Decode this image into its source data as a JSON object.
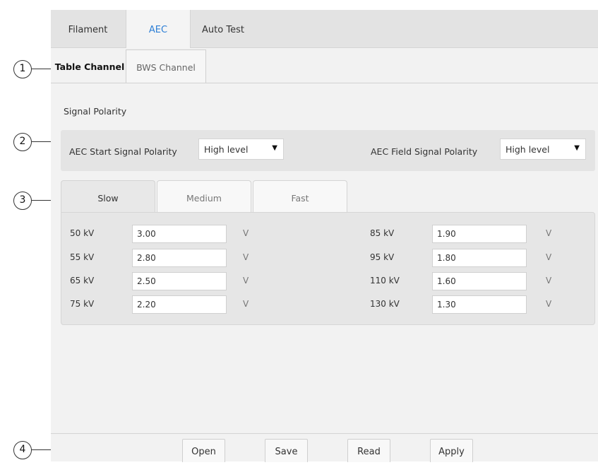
{
  "top_tabs": [
    "Filament",
    "AEC",
    "Auto Test"
  ],
  "sub_tabs": [
    "Table Channel",
    "BWS Channel"
  ],
  "signal_polarity": {
    "section_label": "Signal Polarity",
    "start_label": "AEC Start Signal Polarity",
    "start_value": "High level",
    "field_label": "AEC Field Signal Polarity",
    "field_value": "High level",
    "arrow": "▼"
  },
  "speed_tabs": [
    "Slow",
    "Medium",
    "Fast"
  ],
  "kv_left": [
    {
      "kv": "50 kV",
      "value": "3.00",
      "unit": "V"
    },
    {
      "kv": "55 kV",
      "value": "2.80",
      "unit": "V"
    },
    {
      "kv": "65 kV",
      "value": "2.50",
      "unit": "V"
    },
    {
      "kv": "75 kV",
      "value": "2.20",
      "unit": "V"
    }
  ],
  "kv_right": [
    {
      "kv": "85 kV",
      "value": "1.90",
      "unit": "V"
    },
    {
      "kv": "95 kV",
      "value": "1.80",
      "unit": "V"
    },
    {
      "kv": "110 kV",
      "value": "1.60",
      "unit": "V"
    },
    {
      "kv": "130 kV",
      "value": "1.30",
      "unit": "V"
    }
  ],
  "buttons": [
    "Open",
    "Save",
    "Read",
    "Apply"
  ],
  "callouts": [
    "1",
    "2",
    "3",
    "4"
  ],
  "colors": {
    "active_tab_text": "#2d7fd6"
  }
}
